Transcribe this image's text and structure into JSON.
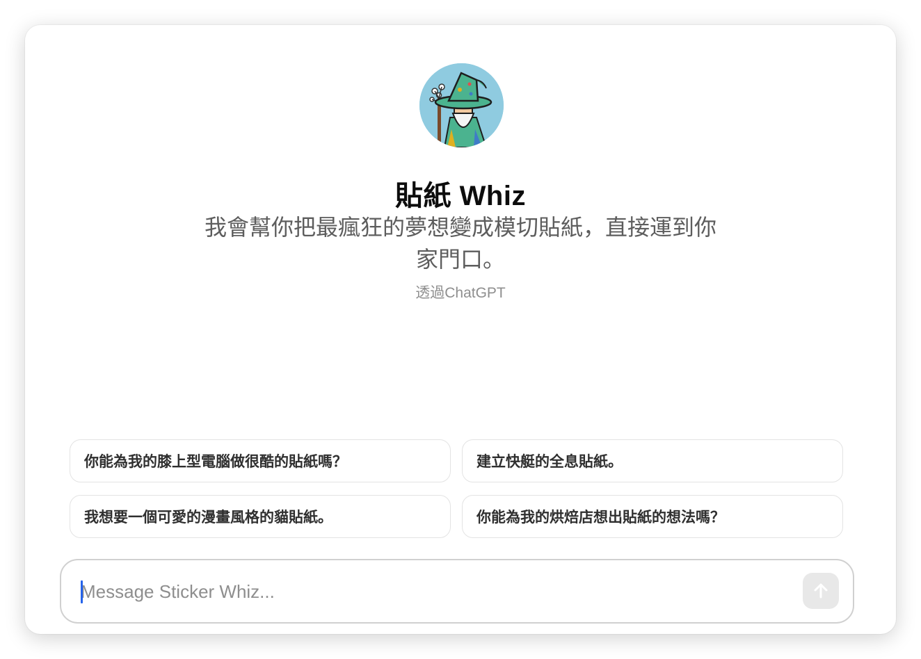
{
  "gpt": {
    "name": "貼紙 Whiz",
    "description": "我會幫你把最瘋狂的夢想變成模切貼紙，直接運到你家門口。",
    "byline": "透過ChatGPT",
    "avatar_icon": "wizard-avatar"
  },
  "suggestions": [
    "你能為我的膝上型電腦做很酷的貼紙嗎？",
    "建立快艇的全息貼紙。",
    "我想要一個可愛的漫畫風格的貓貼紙。",
    "你能為我的烘焙店想出貼紙的想法嗎？"
  ],
  "composer": {
    "placeholder": "Message Sticker Whiz...",
    "value": "",
    "send_icon": "arrow-up-icon"
  },
  "colors": {
    "accent_caret": "#2563eb",
    "send_button_bg": "#e8e8e8",
    "avatar_bg": "#8fcbe0"
  }
}
